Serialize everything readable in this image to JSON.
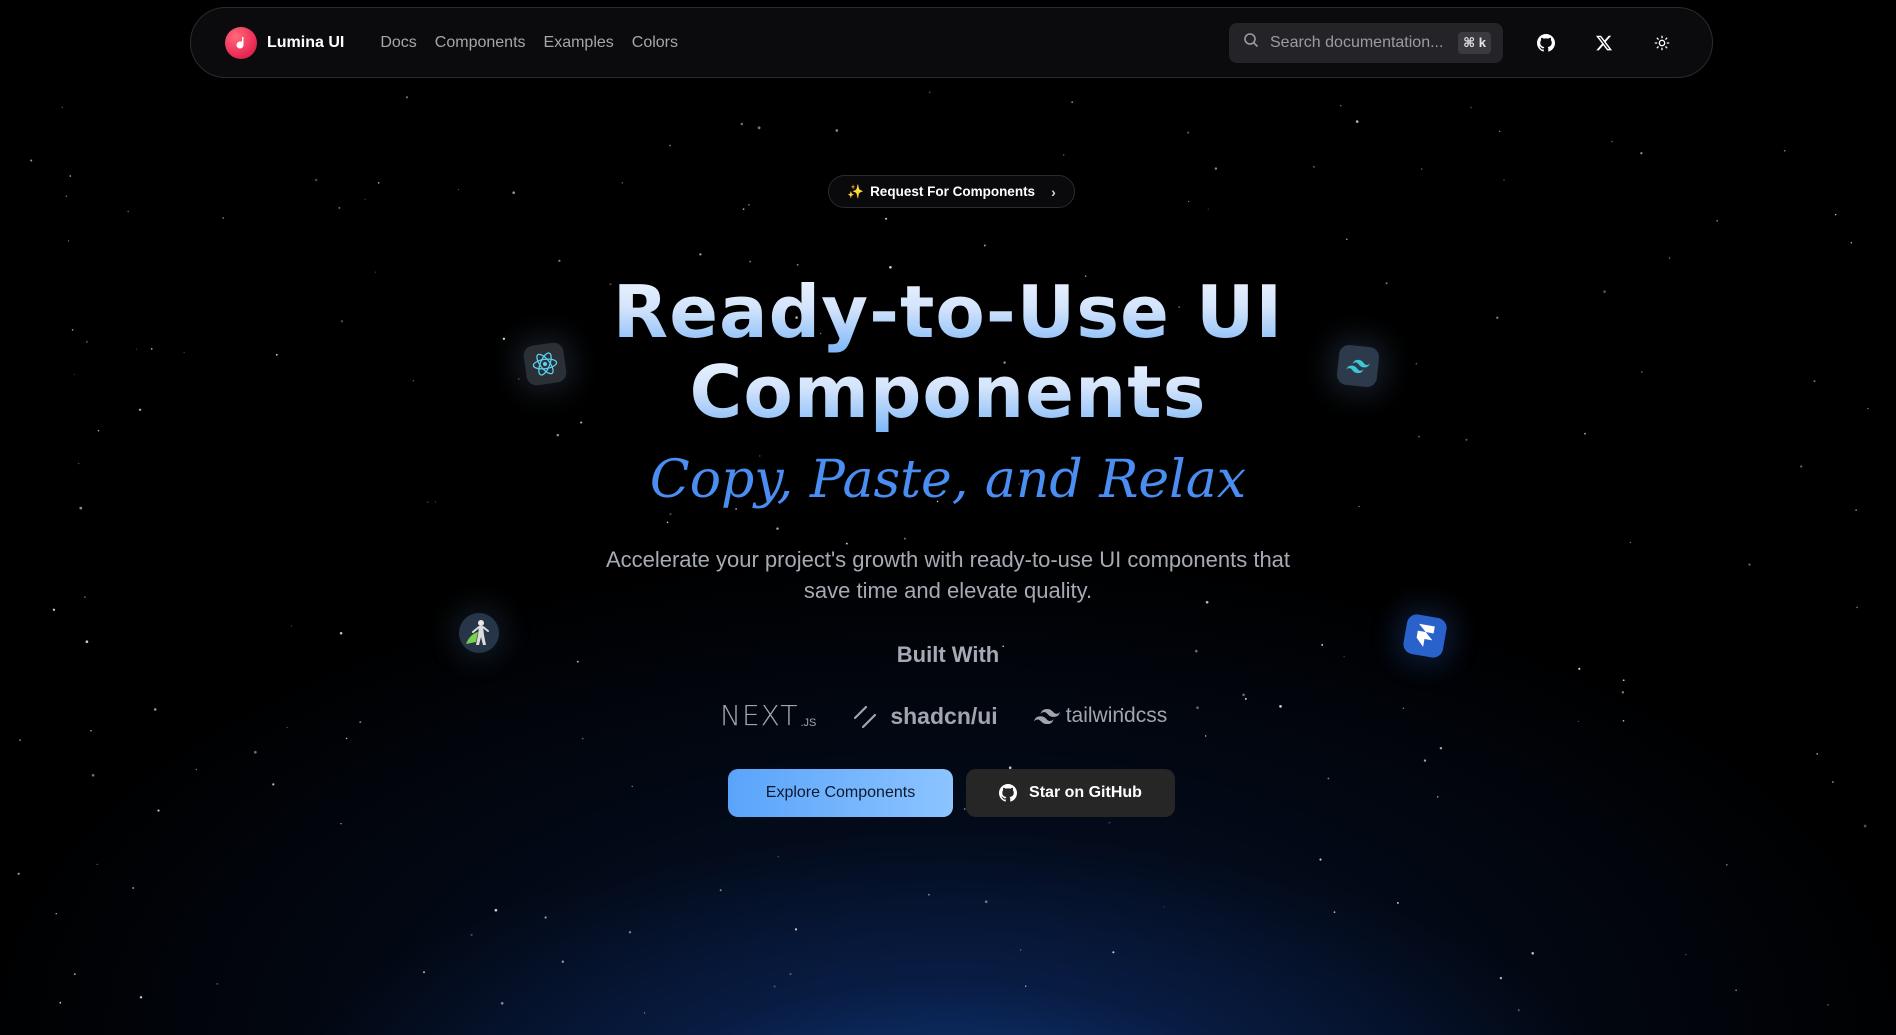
{
  "navbar": {
    "brand": "Lumina UI",
    "links": [
      "Docs",
      "Components",
      "Examples",
      "Colors"
    ],
    "search": {
      "placeholder": "Search documentation...",
      "shortcut": "⌘ k"
    },
    "icons": [
      "search-icon",
      "github-icon",
      "x-logo-icon",
      "sun-icon"
    ]
  },
  "badge": {
    "sparkle": "✨",
    "label": "Request For Components",
    "chevron": "›"
  },
  "hero": {
    "title_line1": "Ready-to-Use UI",
    "title_line2": "Components",
    "subtitle": "Copy, Paste, and Relax",
    "description": "Accelerate your project's growth with ready-to-use UI components that save time and elevate quality.",
    "built_with": "Built With"
  },
  "logos": {
    "next": "NEXT",
    "next_suffix": ".JS",
    "shadcn": "shadcn/ui",
    "tailwind": "tailwindcss"
  },
  "buttons": {
    "primary": "Explore Components",
    "secondary": "Star on GitHub"
  },
  "floating_icons": [
    "react-icon",
    "tailwind-icon",
    "figure-icon",
    "framer-icon"
  ],
  "colors": {
    "background": "#000000",
    "glow": "#1852b2",
    "accent": "#4a8ef2",
    "brand": "#ec2f58",
    "button_primary": "#5aa4fb",
    "button_secondary": "#262626"
  }
}
